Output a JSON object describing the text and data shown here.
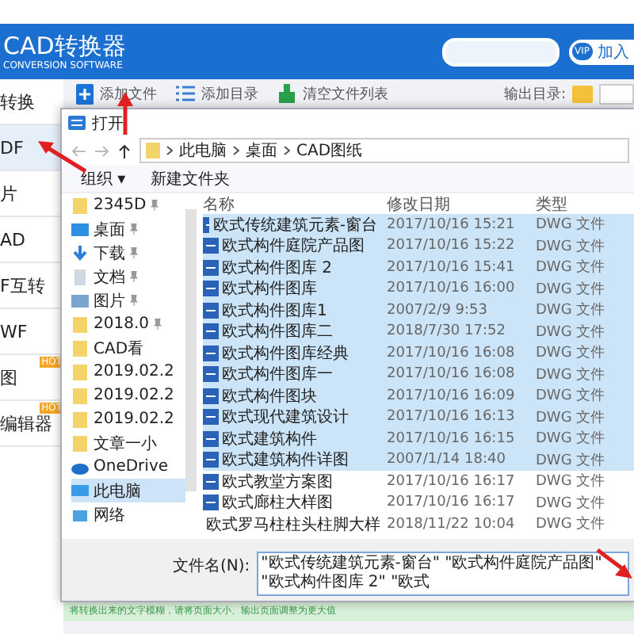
{
  "app": {
    "title": "CAD转换器",
    "subtitle": "CONVERSION SOFTWARE",
    "vip": "VIP",
    "join": "加入"
  },
  "sidebar": {
    "items": [
      {
        "label": "转换",
        "selected": false
      },
      {
        "label": "DF",
        "selected": true
      },
      {
        "label": "片",
        "selected": false
      },
      {
        "label": "AD",
        "selected": false
      },
      {
        "label": "F互转",
        "selected": false
      },
      {
        "label": "WF",
        "selected": false
      },
      {
        "label": "图",
        "selected": false,
        "badge": "HOT"
      },
      {
        "label": "编辑器",
        "selected": false,
        "badge": "HOT"
      }
    ]
  },
  "toolbar": {
    "buttons": [
      {
        "kind": "add-file",
        "label": "添加文件"
      },
      {
        "kind": "add-folder",
        "label": "添加目录"
      },
      {
        "kind": "clear",
        "label": "清空文件列表"
      }
    ],
    "output_label": "输出目录:"
  },
  "dialog": {
    "title": "打开",
    "path": [
      "此电脑",
      "桌面",
      "CAD图纸"
    ],
    "organize": "组织 ▾",
    "new_folder": "新建文件夹",
    "nav": [
      {
        "kind": "folder",
        "label": "2345D",
        "pinned": true,
        "selected": false
      },
      {
        "kind": "desktop",
        "label": "桌面",
        "pinned": true,
        "selected": false
      },
      {
        "kind": "download",
        "label": "下载",
        "pinned": true,
        "selected": false
      },
      {
        "kind": "doc",
        "label": "文档",
        "pinned": true,
        "selected": false
      },
      {
        "kind": "picture",
        "label": "图片",
        "pinned": true,
        "selected": false
      },
      {
        "kind": "folder",
        "label": "2018.0",
        "pinned": true,
        "selected": false
      },
      {
        "kind": "folder",
        "label": "CAD看",
        "pinned": false,
        "selected": false
      },
      {
        "kind": "folder",
        "label": "2019.02.2",
        "pinned": false,
        "selected": false
      },
      {
        "kind": "folder",
        "label": "2019.02.2",
        "pinned": false,
        "selected": false
      },
      {
        "kind": "folder",
        "label": "2019.02.2",
        "pinned": false,
        "selected": false
      },
      {
        "kind": "folder",
        "label": "文章一小",
        "pinned": false,
        "selected": false
      },
      {
        "kind": "cloud",
        "label": "OneDrive",
        "pinned": false,
        "selected": false
      },
      {
        "kind": "pc",
        "label": "此电脑",
        "pinned": false,
        "selected": true
      },
      {
        "kind": "network",
        "label": "网络",
        "pinned": false,
        "selected": false
      }
    ],
    "columns": [
      "名称",
      "修改日期",
      "类型"
    ],
    "rows": [
      {
        "name": "欧式传统建筑元素-窗台",
        "date": "2017/10/16 15:21",
        "type": "DWG 文件",
        "selected": true
      },
      {
        "name": "欧式构件庭院产品图",
        "date": "2017/10/16 15:22",
        "type": "DWG 文件",
        "selected": true
      },
      {
        "name": "欧式构件图库 2",
        "date": "2017/10/16 15:41",
        "type": "DWG 文件",
        "selected": true
      },
      {
        "name": "欧式构件图库",
        "date": "2017/10/16 16:00",
        "type": "DWG 文件",
        "selected": true
      },
      {
        "name": "欧式构件图库1",
        "date": "2007/2/9 9:53",
        "type": "DWG 文件",
        "selected": true
      },
      {
        "name": "欧式构件图库二",
        "date": "2018/7/30 17:52",
        "type": "DWG 文件",
        "selected": true
      },
      {
        "name": "欧式构件图库经典",
        "date": "2017/10/16 16:08",
        "type": "DWG 文件",
        "selected": true
      },
      {
        "name": "欧式构件图库一",
        "date": "2017/10/16 16:08",
        "type": "DWG 文件",
        "selected": true
      },
      {
        "name": "欧式构件图块",
        "date": "2017/10/16 16:09",
        "type": "DWG 文件",
        "selected": true
      },
      {
        "name": "欧式现代建筑设计",
        "date": "2017/10/16 16:13",
        "type": "DWG 文件",
        "selected": true
      },
      {
        "name": "欧式建筑构件",
        "date": "2017/10/16 16:15",
        "type": "DWG 文件",
        "selected": true
      },
      {
        "name": "欧式建筑构件详图",
        "date": "2007/1/14 18:40",
        "type": "DWG 文件",
        "selected": true
      },
      {
        "name": "欧式教堂方案图",
        "date": "2017/10/16 16:17",
        "type": "DWG 文件",
        "selected": false
      },
      {
        "name": "欧式廊柱大样图",
        "date": "2017/10/16 16:17",
        "type": "DWG 文件",
        "selected": false
      },
      {
        "name": "欧式罗马柱柱头柱脚大样",
        "date": "2018/11/22 10:04",
        "type": "DWG 文件",
        "selected": false
      }
    ],
    "filename_label": "文件名(N):",
    "filename": "\"欧式传统建筑元素-窗台\" \"欧式构件庭院产品图\" \"欧式构件图库 2\" \"欧式"
  },
  "status": "将转换出来的文字模糊，请将页面大小、输出页面调整为更大值"
}
